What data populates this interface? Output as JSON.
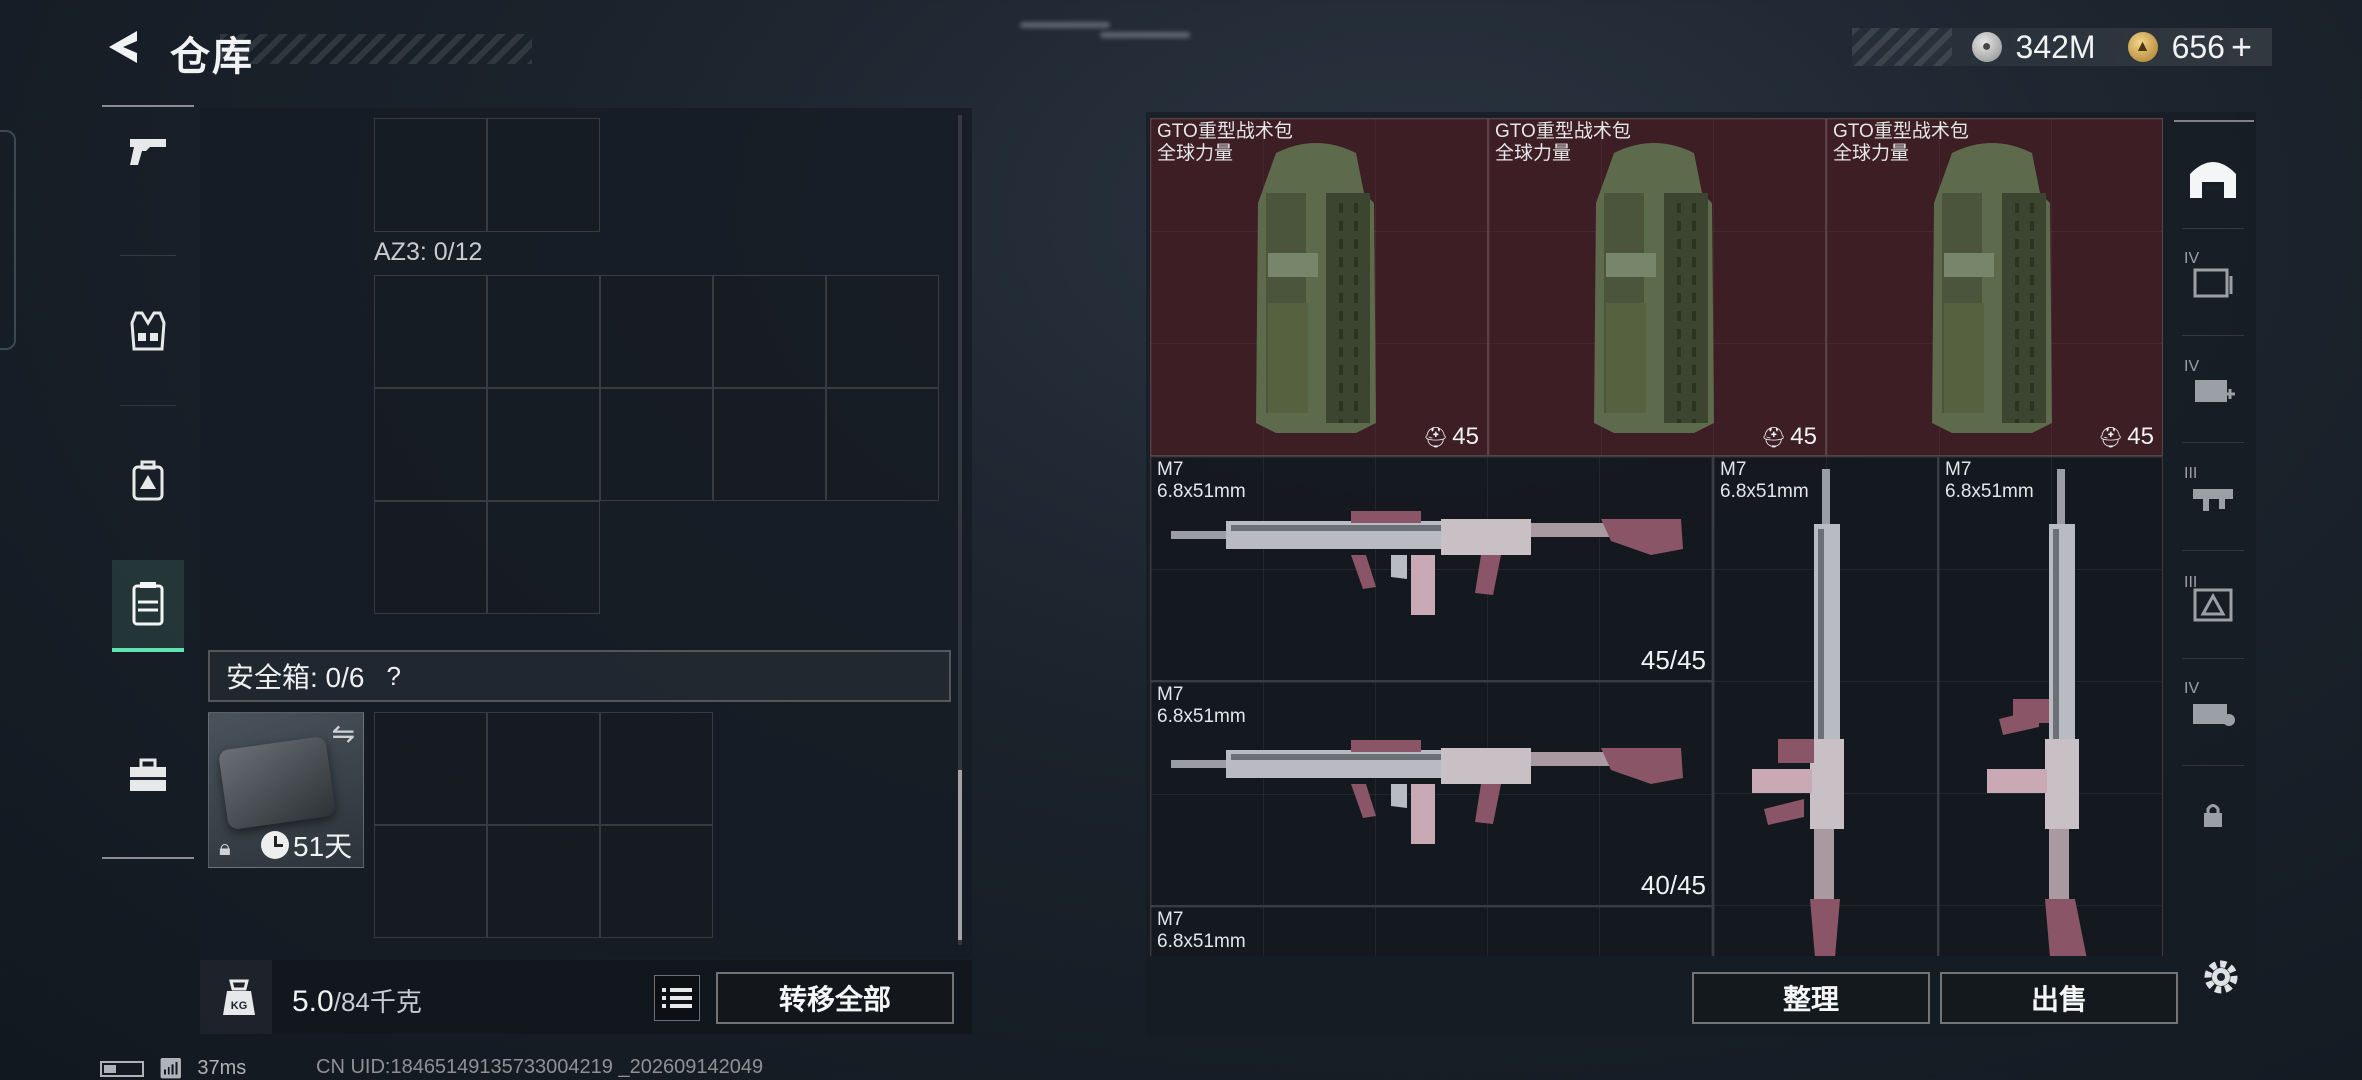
{
  "header": {
    "title": "仓库"
  },
  "currency": [
    {
      "icon": "silver-coin-icon",
      "value": "342M"
    },
    {
      "icon": "gold-coin-icon",
      "value": "656"
    }
  ],
  "currency_plus": "+",
  "left_rail": [
    {
      "icon": "pistol-icon",
      "active": false
    },
    {
      "icon": "vest-icon",
      "active": false
    },
    {
      "icon": "backpack-icon",
      "active": false
    },
    {
      "icon": "locker-icon",
      "active": true
    },
    {
      "icon": "toolbox-icon",
      "active": false
    }
  ],
  "storage": {
    "az3_label": "AZ3: 0/12",
    "safe_label": "安全箱: 0/6",
    "safe_help": "?",
    "safe_days": "51天",
    "weight_current": "5.0",
    "weight_max": "/84千克",
    "transfer_all": "转移全部"
  },
  "items": {
    "backpacks": [
      {
        "name": "GTO重型战术包",
        "sub": "全球力量",
        "level": "45"
      },
      {
        "name": "GTO重型战术包",
        "sub": "全球力量",
        "level": "45"
      },
      {
        "name": "GTO重型战术包",
        "sub": "全球力量",
        "level": "45"
      }
    ],
    "rifles": [
      {
        "name": "M7",
        "caliber": "6.8x51mm",
        "ammo": "45/45"
      },
      {
        "name": "M7",
        "caliber": "6.8x51mm",
        "ammo": "40/45"
      },
      {
        "name": "M7",
        "caliber": "6.8x51mm"
      },
      {
        "name": "M7",
        "caliber": "6.8x51mm"
      },
      {
        "name": "M7",
        "caliber": "6.8x51mm"
      }
    ]
  },
  "right_rail": [
    {
      "icon": "warehouse-icon",
      "label": ""
    },
    {
      "icon": "storage-iv-icon",
      "label": "IV"
    },
    {
      "icon": "medical-iv-icon",
      "label": "IV"
    },
    {
      "icon": "weapon-iii-icon",
      "label": "III"
    },
    {
      "icon": "armor-iii-icon",
      "label": "III"
    },
    {
      "icon": "tools-iv-icon",
      "label": "IV"
    },
    {
      "icon": "lock-icon",
      "label": ""
    }
  ],
  "actions": {
    "organize": "整理",
    "sell": "出售"
  },
  "status": {
    "ping": "37ms",
    "uid": "CN UID:18465149135733004219 _202609142049"
  },
  "colors": {
    "accent": "#5fe3b0",
    "backpack_bg": "#3c1e24"
  }
}
